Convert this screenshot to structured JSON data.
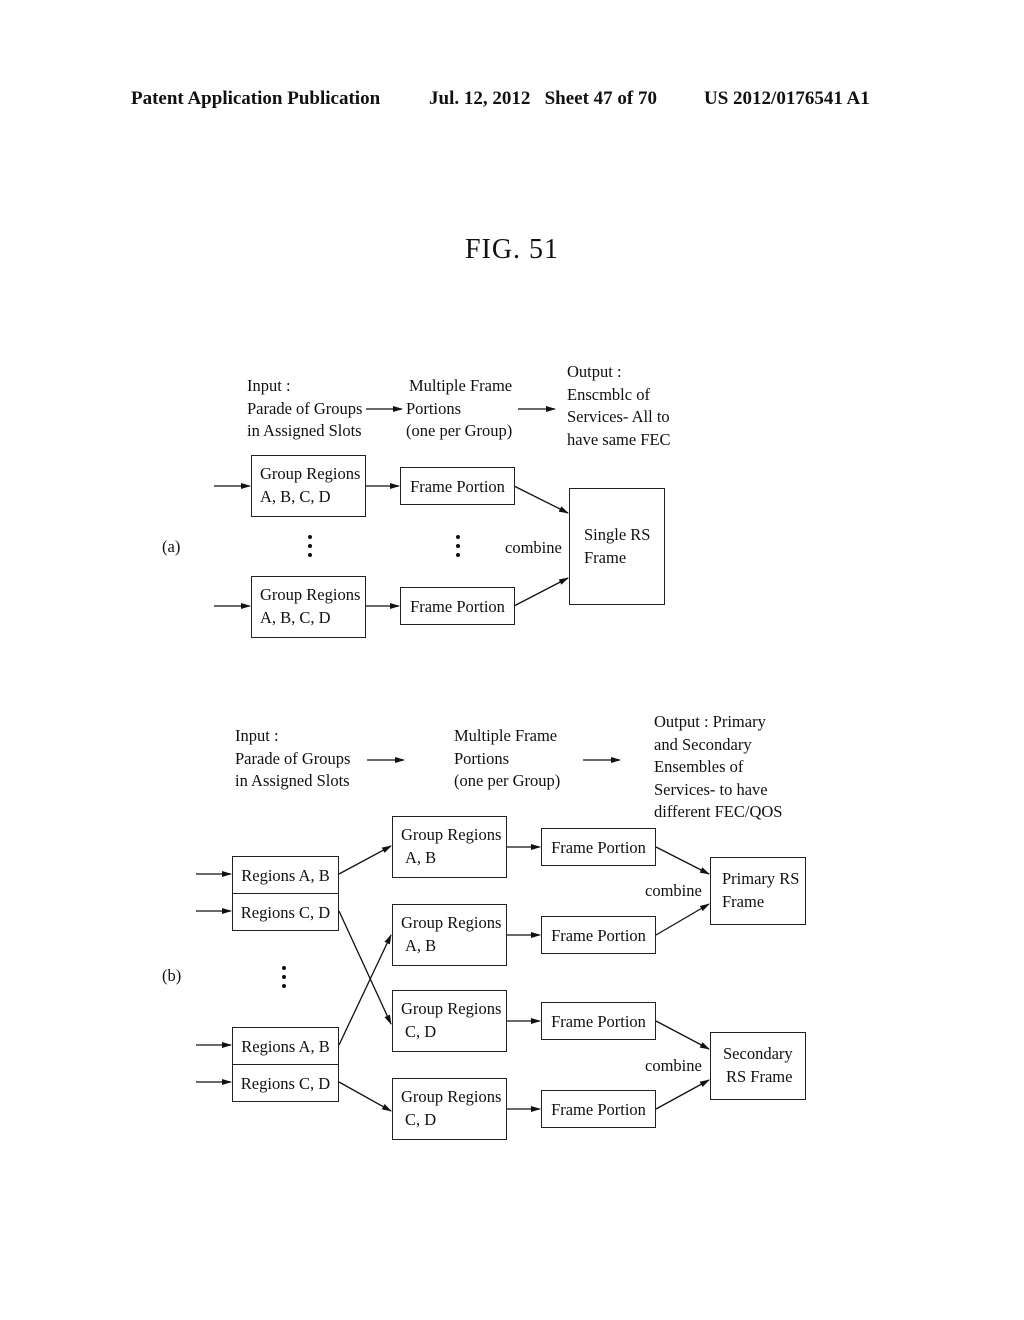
{
  "header": {
    "publication": "Patent Application Publication",
    "date_sheet": "Jul. 12, 2012   Sheet 47 of 70",
    "patent_number": "US 2012/0176541 A1"
  },
  "figure_title": "FIG. 51",
  "panel_a": {
    "label": "(a)",
    "input_label": [
      "Input :",
      "Parade of Groups",
      "in Assigned Slots"
    ],
    "middle_label": [
      "Multiple Frame",
      "Portions",
      "(one per Group)"
    ],
    "output_label": [
      "Output :",
      "Enscmblc of",
      "Services- All to",
      "have same FEC"
    ],
    "group_boxes": [
      {
        "line1": "Group Regions",
        "line2": "A, B, C, D"
      },
      {
        "line1": "Group Regions",
        "line2": "A, B, C, D"
      }
    ],
    "frame_portions": [
      "Frame Portion",
      "Frame Portion"
    ],
    "combine_label": "combine",
    "result_box": [
      "Single RS",
      "Frame"
    ]
  },
  "panel_b": {
    "label": "(b)",
    "input_label": [
      "Input :",
      "Parade of Groups",
      "in Assigned Slots"
    ],
    "middle_label": [
      "Multiple Frame",
      "Portions",
      "(one per Group)"
    ],
    "output_label": [
      "Output : Primary",
      "and Secondary",
      "Ensembles of",
      "Services- to have",
      "different FEC/QOS"
    ],
    "region_boxes": [
      "Regions A, B",
      "Regions C, D",
      "Regions A, B",
      "Regions C, D"
    ],
    "group_boxes": [
      {
        "line1": "Group Regions",
        "line2": "A, B"
      },
      {
        "line1": "Group Regions",
        "line2": "A, B"
      },
      {
        "line1": "Group Regions",
        "line2": "C, D"
      },
      {
        "line1": "Group Regions",
        "line2": "C, D"
      }
    ],
    "frame_portions": [
      "Frame Portion",
      "Frame Portion",
      "Frame Portion",
      "Frame Portion"
    ],
    "combine_labels": [
      "combine",
      "combine"
    ],
    "primary_box": [
      "Primary RS",
      "Frame"
    ],
    "secondary_box": [
      "Secondary",
      "RS Frame"
    ]
  }
}
